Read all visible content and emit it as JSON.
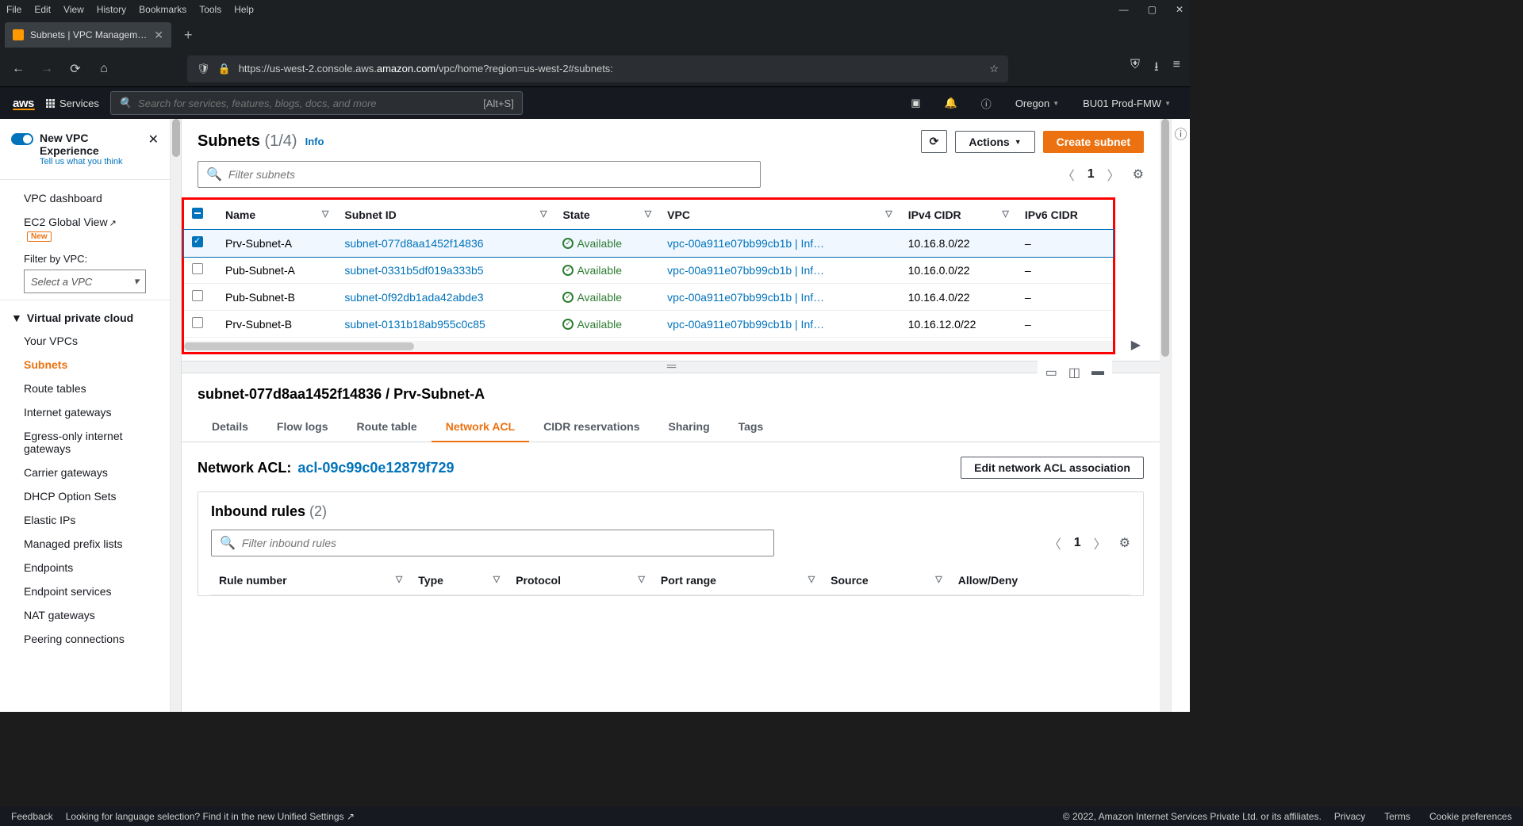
{
  "browser": {
    "menus": [
      "File",
      "Edit",
      "View",
      "History",
      "Bookmarks",
      "Tools",
      "Help"
    ],
    "tab_title": "Subnets | VPC Management Con",
    "url_pre": "https://us-west-2.console.aws.",
    "url_dom": "amazon.com",
    "url_post": "/vpc/home?region=us-west-2#subnets:"
  },
  "aws_header": {
    "services": "Services",
    "search_placeholder": "Search for services, features, blogs, docs, and more",
    "search_hint": "[Alt+S]",
    "region": "Oregon",
    "account": "BU01 Prod-FMW"
  },
  "sidebar": {
    "experience_title": "New VPC Experience",
    "experience_sub": "Tell us what you think",
    "dashboard": "VPC dashboard",
    "ec2_global": "EC2 Global View",
    "badge_new": "New",
    "filter_label": "Filter by VPC:",
    "filter_placeholder": "Select a VPC",
    "section": "Virtual private cloud",
    "items": [
      "Your VPCs",
      "Subnets",
      "Route tables",
      "Internet gateways",
      "Egress-only internet gateways",
      "Carrier gateways",
      "DHCP Option Sets",
      "Elastic IPs",
      "Managed prefix lists",
      "Endpoints",
      "Endpoint services",
      "NAT gateways",
      "Peering connections"
    ]
  },
  "heading": {
    "title": "Subnets",
    "count": "(1/4)",
    "info": "Info",
    "actions": "Actions",
    "create": "Create subnet"
  },
  "filter": {
    "placeholder": "Filter subnets",
    "page": "1"
  },
  "table": {
    "cols": [
      "Name",
      "Subnet ID",
      "State",
      "VPC",
      "IPv4 CIDR",
      "IPv6 CIDR"
    ],
    "rows": [
      {
        "sel": true,
        "name": "Prv-Subnet-A",
        "id": "subnet-077d8aa1452f14836",
        "state": "Available",
        "vpc": "vpc-00a911e07bb99cb1b | Inf…",
        "cidr4": "10.16.8.0/22",
        "cidr6": "–"
      },
      {
        "sel": false,
        "name": "Pub-Subnet-A",
        "id": "subnet-0331b5df019a333b5",
        "state": "Available",
        "vpc": "vpc-00a911e07bb99cb1b | Inf…",
        "cidr4": "10.16.0.0/22",
        "cidr6": "–"
      },
      {
        "sel": false,
        "name": "Pub-Subnet-B",
        "id": "subnet-0f92db1ada42abde3",
        "state": "Available",
        "vpc": "vpc-00a911e07bb99cb1b | Inf…",
        "cidr4": "10.16.4.0/22",
        "cidr6": "–"
      },
      {
        "sel": false,
        "name": "Prv-Subnet-B",
        "id": "subnet-0131b18ab955c0c85",
        "state": "Available",
        "vpc": "vpc-00a911e07bb99cb1b | Inf…",
        "cidr4": "10.16.12.0/22",
        "cidr6": "–"
      }
    ]
  },
  "detail": {
    "title": "subnet-077d8aa1452f14836 / Prv-Subnet-A",
    "tabs": [
      "Details",
      "Flow logs",
      "Route table",
      "Network ACL",
      "CIDR reservations",
      "Sharing",
      "Tags"
    ],
    "active_tab": 3,
    "acl_label": "Network ACL:",
    "acl_id": "acl-09c99c0e12879f729",
    "edit_btn": "Edit network ACL association",
    "inbound_title": "Inbound rules",
    "inbound_count": "(2)",
    "inbound_filter": "Filter inbound rules",
    "inbound_page": "1",
    "inbound_cols": [
      "Rule number",
      "Type",
      "Protocol",
      "Port range",
      "Source",
      "Allow/Deny"
    ]
  },
  "footer": {
    "feedback": "Feedback",
    "lang": "Looking for language selection? Find it in the new",
    "unified": "Unified Settings",
    "copyright": "© 2022, Amazon Internet Services Private Ltd. or its affiliates.",
    "links": [
      "Privacy",
      "Terms",
      "Cookie preferences"
    ]
  }
}
